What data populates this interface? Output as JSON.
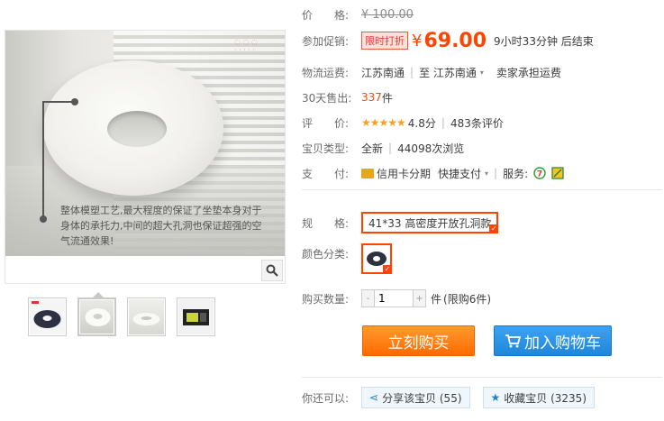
{
  "gallery": {
    "overlay_text": "整体模塑工艺,最大程度的保证了坐垫本身对于身体的承托力,中间的超大孔洞也保证超强的空气流通效果!",
    "zoom_icon": "magnifier-icon",
    "thumbnails": [
      {
        "name": "thumb-1"
      },
      {
        "name": "thumb-2"
      },
      {
        "name": "thumb-3"
      },
      {
        "name": "thumb-4"
      }
    ]
  },
  "info": {
    "price_label": "价　　格:",
    "original_price": "¥ 100.00",
    "promo_label": "参加促销:",
    "promo_tag": "限时打折",
    "currency": "¥",
    "sale_price": "69.00",
    "countdown": "9小时33分钟 后结束",
    "shipping_label": "物流运费:",
    "shipping_from": "江苏南通",
    "shipping_sep": "|",
    "shipping_to": "至 江苏南通",
    "shipping_fee": "卖家承担运费",
    "sales_label": "30天售出:",
    "sales_count": "337",
    "sales_unit": "件",
    "rating_label": "评　　价:",
    "rating_stars": "★★★★★",
    "rating_value": "4.8分",
    "review_count": "483条评价",
    "type_label": "宝贝类型:",
    "condition": "全新",
    "views": "44098次浏览",
    "pay_label": "支　　付:",
    "pay_installment": "信用卡分期",
    "pay_quick": "快捷支付",
    "service_label": "服务:",
    "size_label": "规　　格:",
    "size_option": "41*33 高密度开放孔洞款",
    "color_label": "颜色分类:",
    "qty_label": "购买数量:",
    "qty_minus": "-",
    "qty_value": "1",
    "qty_plus": "+",
    "qty_unit": "件",
    "qty_limit": "(限购6件)",
    "buy_now": "立刻购买",
    "add_to_cart": "加入购物车",
    "you_can_label": "你还可以:",
    "share_label": "分享该宝贝 (55)",
    "favorite_label": "收藏宝贝 (3235)"
  },
  "colors": {
    "accent": "#ff4400",
    "buy": "#ff6a00",
    "cart": "#1f86d8",
    "star": "#f7a11b"
  }
}
